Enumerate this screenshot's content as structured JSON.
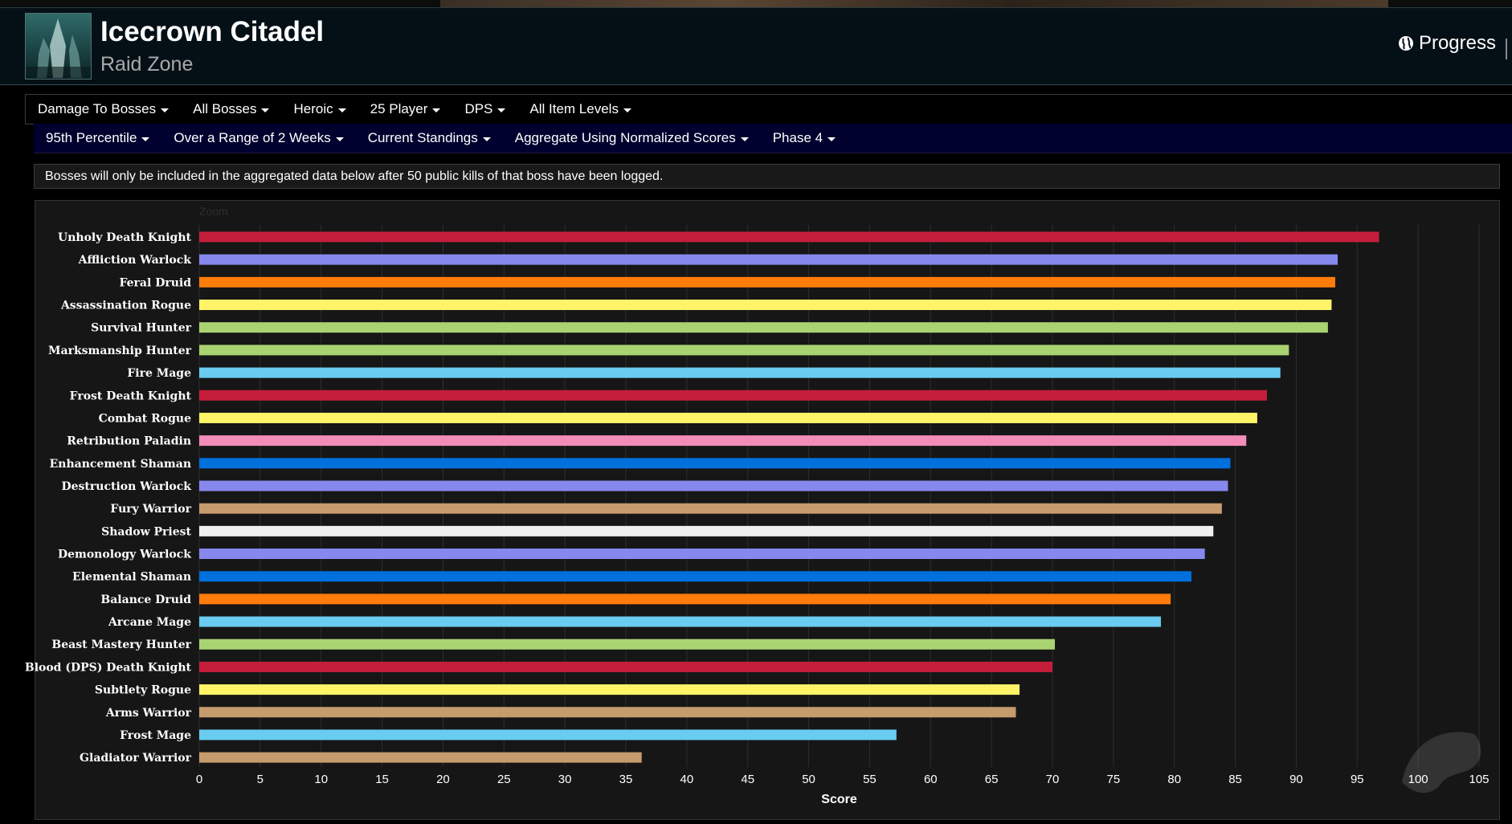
{
  "header": {
    "title": "Icecrown Citadel",
    "subtitle": "Raid Zone",
    "progress_label": "Progress"
  },
  "filters_row1": [
    {
      "label": "Damage To Bosses"
    },
    {
      "label": "All Bosses"
    },
    {
      "label": "Heroic"
    },
    {
      "label": "25 Player"
    },
    {
      "label": "DPS"
    },
    {
      "label": "All Item Levels"
    }
  ],
  "filters_row2": [
    {
      "label": "95th Percentile"
    },
    {
      "label": "Over a Range of 2 Weeks"
    },
    {
      "label": "Current Standings"
    },
    {
      "label": "Aggregate Using Normalized Scores"
    },
    {
      "label": "Phase 4"
    }
  ],
  "notice": "Bosses will only be included in the aggregated data below after 50 public kills of that boss have been logged.",
  "chart": {
    "zoom_label": "Zoom"
  },
  "colors": {
    "header_bg": "#051016",
    "filter_bar_2_bg": "#00002e",
    "chart_bg": "#161616"
  },
  "chart_data": {
    "type": "bar",
    "orientation": "horizontal",
    "title": "",
    "xlabel": "Score",
    "ylabel": "",
    "xlim": [
      0,
      105
    ],
    "xticks": [
      0,
      5,
      10,
      15,
      20,
      25,
      30,
      35,
      40,
      45,
      50,
      55,
      60,
      65,
      70,
      75,
      80,
      85,
      90,
      95,
      100,
      105
    ],
    "grid": "vertical",
    "categories": [
      "Unholy Death Knight",
      "Affliction Warlock",
      "Feral Druid",
      "Assassination Rogue",
      "Survival Hunter",
      "Marksmanship Hunter",
      "Fire Mage",
      "Frost Death Knight",
      "Combat Rogue",
      "Retribution Paladin",
      "Enhancement Shaman",
      "Destruction Warlock",
      "Fury Warrior",
      "Shadow Priest",
      "Demonology Warlock",
      "Elemental Shaman",
      "Balance Druid",
      "Arcane Mage",
      "Beast Mastery Hunter",
      "Blood (DPS) Death Knight",
      "Subtlety Rogue",
      "Arms Warrior",
      "Frost Mage",
      "Gladiator Warrior"
    ],
    "values": [
      96.8,
      93.4,
      93.2,
      92.9,
      92.6,
      89.4,
      88.7,
      87.6,
      86.8,
      85.9,
      84.6,
      84.4,
      83.9,
      83.2,
      82.5,
      81.4,
      79.7,
      78.9,
      70.2,
      70.0,
      67.3,
      67.0,
      57.2,
      36.3
    ],
    "bar_colors": [
      "#C41E3A",
      "#8788EE",
      "#FF7C0A",
      "#FFF468",
      "#AAD372",
      "#AAD372",
      "#69CCF0",
      "#C41E3A",
      "#FFF468",
      "#F48CBA",
      "#0070DD",
      "#8788EE",
      "#C69B6D",
      "#F0F0F0",
      "#8788EE",
      "#0070DD",
      "#FF7C0A",
      "#69CCF0",
      "#AAD372",
      "#C41E3A",
      "#FFF468",
      "#C69B6D",
      "#69CCF0",
      "#C69B6D"
    ]
  }
}
